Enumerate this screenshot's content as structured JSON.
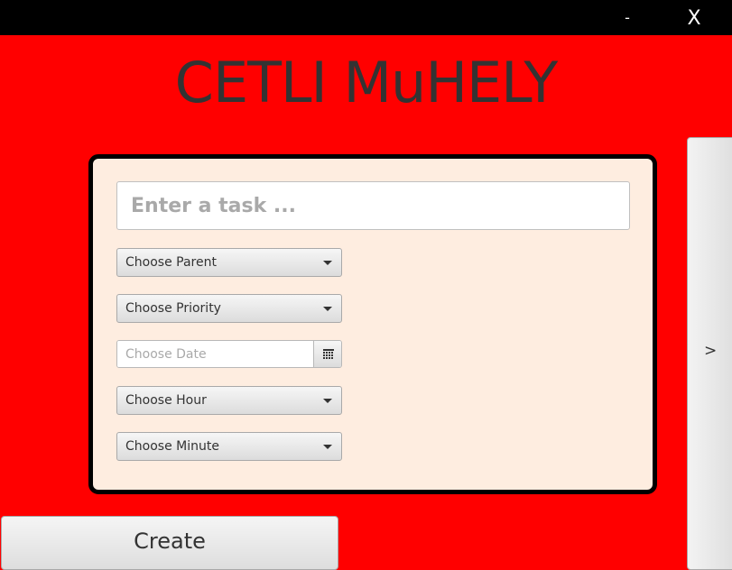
{
  "window": {
    "minimize_label": "-",
    "close_label": "X"
  },
  "app_title": "CETLI MuHELY",
  "form": {
    "task_placeholder": "Enter a task ...",
    "parent_label": "Choose Parent",
    "priority_label": "Choose Priority",
    "date_placeholder": "Choose Date",
    "hour_label": "Choose Hour",
    "minute_label": "Choose Minute"
  },
  "create_label": "Create",
  "side_panel": {
    "arrow_label": ">"
  },
  "colors": {
    "background": "#ff0000",
    "titlebar": "#000000",
    "card": "#feede0",
    "title_text": "#333333"
  }
}
